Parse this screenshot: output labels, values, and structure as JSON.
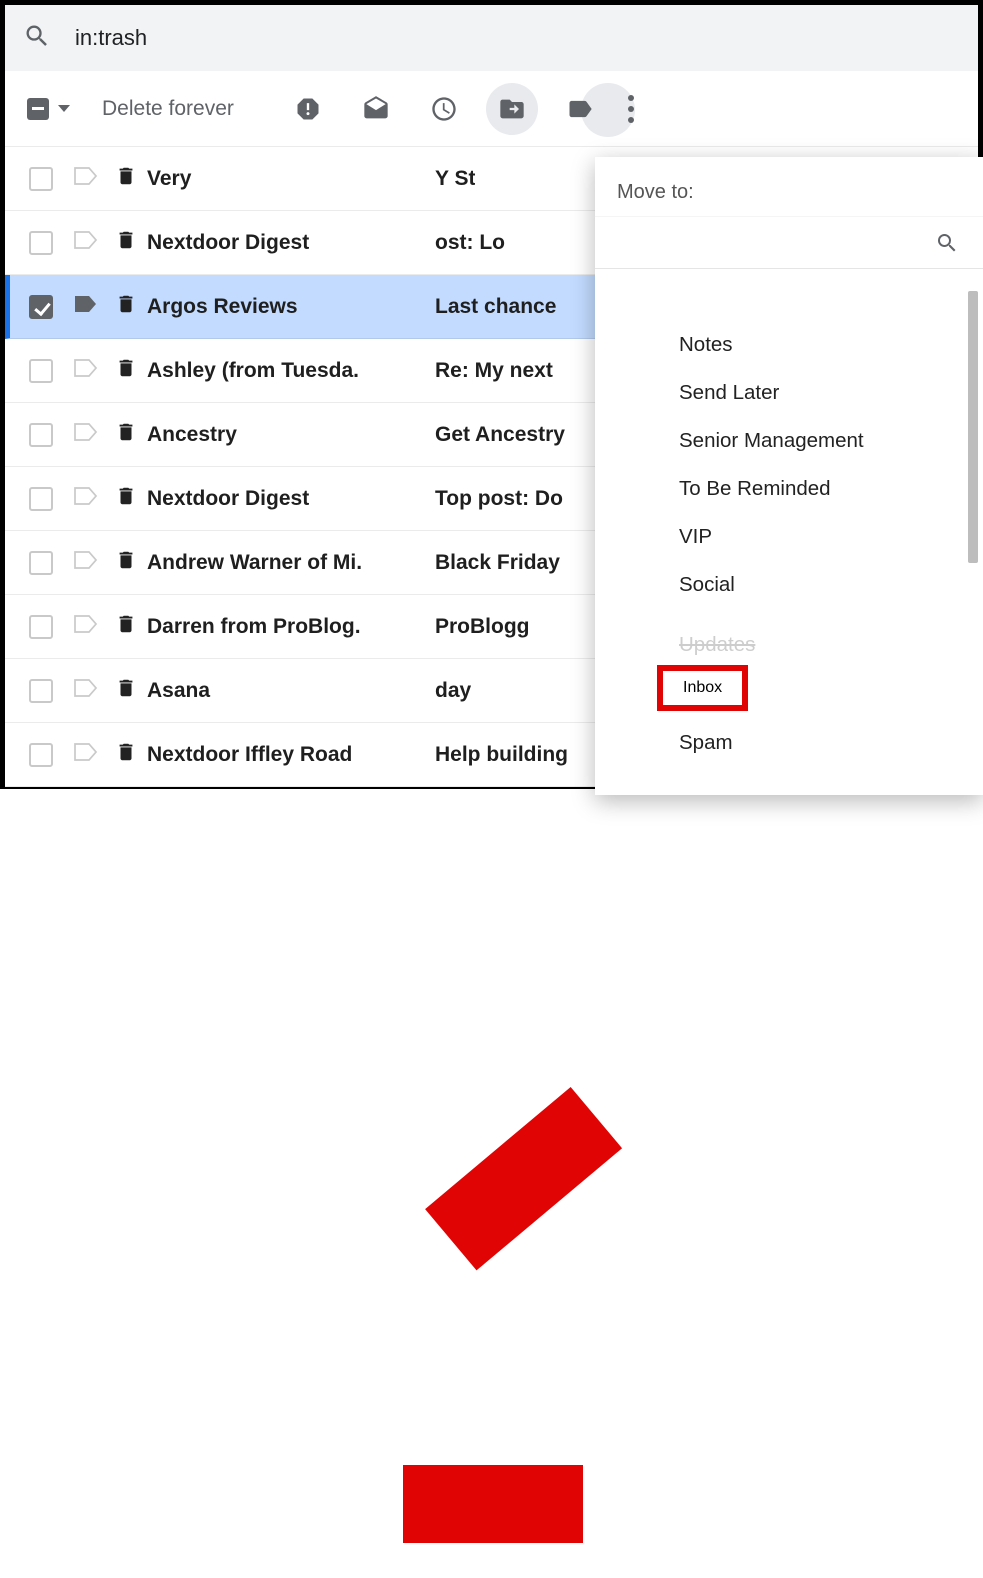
{
  "search": {
    "query": "in:trash",
    "placeholder": ""
  },
  "toolbar": {
    "delete_forever": "Delete forever"
  },
  "emails": [
    {
      "sender": "Very",
      "subject": "Y               St"
    },
    {
      "sender": "Nextdoor Digest",
      "subject": "          ost: Lo"
    },
    {
      "sender": "Argos Reviews",
      "subject": "Last chance",
      "selected": true
    },
    {
      "sender": "Ashley (from Tuesda.",
      "subject": "Re: My next"
    },
    {
      "sender": "Ancestry",
      "subject": "Get Ancestry"
    },
    {
      "sender": "Nextdoor Digest",
      "subject": "Top post: Do"
    },
    {
      "sender": "Andrew Warner of Mi.",
      "subject": "Black Friday"
    },
    {
      "sender": "Darren from ProBlog.",
      "subject": "     ProBlogg"
    },
    {
      "sender": "Asana",
      "subject": "            day"
    },
    {
      "sender": "Nextdoor Iffley Road",
      "subject": "Help building"
    }
  ],
  "move_popup": {
    "title": "Move to:",
    "items": {
      "notes": "Notes",
      "send_later": "Send Later",
      "senior_management": "Senior Management",
      "to_be_reminded": "To Be Reminded",
      "vip": "VIP",
      "social": "Social",
      "updates": "Updates",
      "inbox": "Inbox",
      "spam": "Spam"
    }
  },
  "annotation": {
    "color": "#e00404"
  }
}
